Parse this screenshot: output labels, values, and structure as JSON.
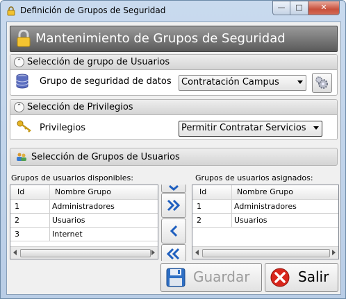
{
  "window": {
    "title": "Definición de Grupos de Seguridad",
    "controls": {
      "minimize": "—",
      "maximize": "□",
      "close": "✕"
    }
  },
  "header": {
    "title": "Mantenimiento de Grupos de Seguridad",
    "icon": "lock-icon"
  },
  "section_user_group": {
    "title": "Selección de grupo de Usuarios",
    "field_label": "Grupo de seguridad de datos",
    "field_value": "Contratación Campus",
    "icon": "database-icon",
    "action_icon": "gears-icon"
  },
  "section_privileges": {
    "title": "Selección de Privilegios",
    "field_label": "Privilegios",
    "field_value": "Permitir Contratar Servicios",
    "icon": "keys-icon"
  },
  "section_groups": {
    "title": "Selección de Grupos de Usuarios",
    "icon": "users-icon"
  },
  "available": {
    "label": "Grupos de usuarios disponibles:",
    "columns": [
      "Id",
      "Nombre Grupo"
    ],
    "rows": [
      {
        "id": "1",
        "name": "Administradores"
      },
      {
        "id": "2",
        "name": "Usuarios"
      },
      {
        "id": "3",
        "name": "Internet"
      }
    ]
  },
  "assigned": {
    "label": "Grupos de usuarios asignados:",
    "columns": [
      "Id",
      "Nombre Grupo"
    ],
    "rows": [
      {
        "id": "1",
        "name": "Administradores"
      },
      {
        "id": "2",
        "name": "Usuarios"
      }
    ]
  },
  "move_buttons": [
    "chevron-down-icon",
    "double-chevron-right-icon",
    "chevron-left-icon",
    "double-chevron-left-icon"
  ],
  "buttons": {
    "save": {
      "label": "Guardar",
      "enabled": false,
      "icon": "floppy-disk-icon"
    },
    "exit": {
      "label": "Salir",
      "enabled": true,
      "icon": "close-circle-icon"
    }
  },
  "colors": {
    "accent_blue": "#1f5fbf",
    "exit_red": "#d8261c",
    "header_gray": "#7a7a7a"
  }
}
